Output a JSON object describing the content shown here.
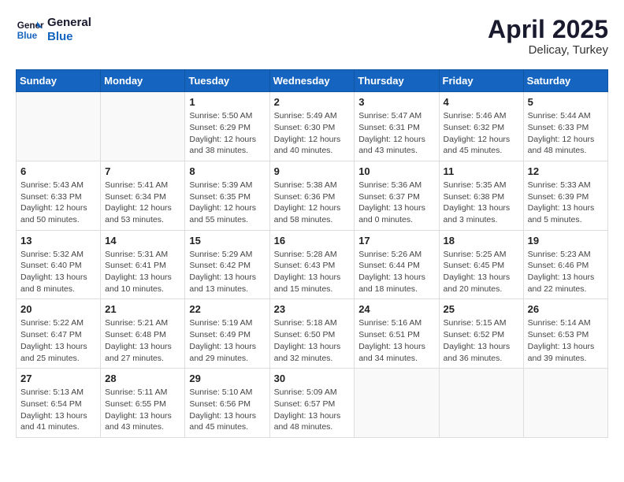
{
  "header": {
    "logo_line1": "General",
    "logo_line2": "Blue",
    "month": "April 2025",
    "location": "Delicay, Turkey"
  },
  "days_of_week": [
    "Sunday",
    "Monday",
    "Tuesday",
    "Wednesday",
    "Thursday",
    "Friday",
    "Saturday"
  ],
  "weeks": [
    [
      {
        "day": "",
        "info": ""
      },
      {
        "day": "",
        "info": ""
      },
      {
        "day": "1",
        "info": "Sunrise: 5:50 AM\nSunset: 6:29 PM\nDaylight: 12 hours and 38 minutes."
      },
      {
        "day": "2",
        "info": "Sunrise: 5:49 AM\nSunset: 6:30 PM\nDaylight: 12 hours and 40 minutes."
      },
      {
        "day": "3",
        "info": "Sunrise: 5:47 AM\nSunset: 6:31 PM\nDaylight: 12 hours and 43 minutes."
      },
      {
        "day": "4",
        "info": "Sunrise: 5:46 AM\nSunset: 6:32 PM\nDaylight: 12 hours and 45 minutes."
      },
      {
        "day": "5",
        "info": "Sunrise: 5:44 AM\nSunset: 6:33 PM\nDaylight: 12 hours and 48 minutes."
      }
    ],
    [
      {
        "day": "6",
        "info": "Sunrise: 5:43 AM\nSunset: 6:33 PM\nDaylight: 12 hours and 50 minutes."
      },
      {
        "day": "7",
        "info": "Sunrise: 5:41 AM\nSunset: 6:34 PM\nDaylight: 12 hours and 53 minutes."
      },
      {
        "day": "8",
        "info": "Sunrise: 5:39 AM\nSunset: 6:35 PM\nDaylight: 12 hours and 55 minutes."
      },
      {
        "day": "9",
        "info": "Sunrise: 5:38 AM\nSunset: 6:36 PM\nDaylight: 12 hours and 58 minutes."
      },
      {
        "day": "10",
        "info": "Sunrise: 5:36 AM\nSunset: 6:37 PM\nDaylight: 13 hours and 0 minutes."
      },
      {
        "day": "11",
        "info": "Sunrise: 5:35 AM\nSunset: 6:38 PM\nDaylight: 13 hours and 3 minutes."
      },
      {
        "day": "12",
        "info": "Sunrise: 5:33 AM\nSunset: 6:39 PM\nDaylight: 13 hours and 5 minutes."
      }
    ],
    [
      {
        "day": "13",
        "info": "Sunrise: 5:32 AM\nSunset: 6:40 PM\nDaylight: 13 hours and 8 minutes."
      },
      {
        "day": "14",
        "info": "Sunrise: 5:31 AM\nSunset: 6:41 PM\nDaylight: 13 hours and 10 minutes."
      },
      {
        "day": "15",
        "info": "Sunrise: 5:29 AM\nSunset: 6:42 PM\nDaylight: 13 hours and 13 minutes."
      },
      {
        "day": "16",
        "info": "Sunrise: 5:28 AM\nSunset: 6:43 PM\nDaylight: 13 hours and 15 minutes."
      },
      {
        "day": "17",
        "info": "Sunrise: 5:26 AM\nSunset: 6:44 PM\nDaylight: 13 hours and 18 minutes."
      },
      {
        "day": "18",
        "info": "Sunrise: 5:25 AM\nSunset: 6:45 PM\nDaylight: 13 hours and 20 minutes."
      },
      {
        "day": "19",
        "info": "Sunrise: 5:23 AM\nSunset: 6:46 PM\nDaylight: 13 hours and 22 minutes."
      }
    ],
    [
      {
        "day": "20",
        "info": "Sunrise: 5:22 AM\nSunset: 6:47 PM\nDaylight: 13 hours and 25 minutes."
      },
      {
        "day": "21",
        "info": "Sunrise: 5:21 AM\nSunset: 6:48 PM\nDaylight: 13 hours and 27 minutes."
      },
      {
        "day": "22",
        "info": "Sunrise: 5:19 AM\nSunset: 6:49 PM\nDaylight: 13 hours and 29 minutes."
      },
      {
        "day": "23",
        "info": "Sunrise: 5:18 AM\nSunset: 6:50 PM\nDaylight: 13 hours and 32 minutes."
      },
      {
        "day": "24",
        "info": "Sunrise: 5:16 AM\nSunset: 6:51 PM\nDaylight: 13 hours and 34 minutes."
      },
      {
        "day": "25",
        "info": "Sunrise: 5:15 AM\nSunset: 6:52 PM\nDaylight: 13 hours and 36 minutes."
      },
      {
        "day": "26",
        "info": "Sunrise: 5:14 AM\nSunset: 6:53 PM\nDaylight: 13 hours and 39 minutes."
      }
    ],
    [
      {
        "day": "27",
        "info": "Sunrise: 5:13 AM\nSunset: 6:54 PM\nDaylight: 13 hours and 41 minutes."
      },
      {
        "day": "28",
        "info": "Sunrise: 5:11 AM\nSunset: 6:55 PM\nDaylight: 13 hours and 43 minutes."
      },
      {
        "day": "29",
        "info": "Sunrise: 5:10 AM\nSunset: 6:56 PM\nDaylight: 13 hours and 45 minutes."
      },
      {
        "day": "30",
        "info": "Sunrise: 5:09 AM\nSunset: 6:57 PM\nDaylight: 13 hours and 48 minutes."
      },
      {
        "day": "",
        "info": ""
      },
      {
        "day": "",
        "info": ""
      },
      {
        "day": "",
        "info": ""
      }
    ]
  ]
}
